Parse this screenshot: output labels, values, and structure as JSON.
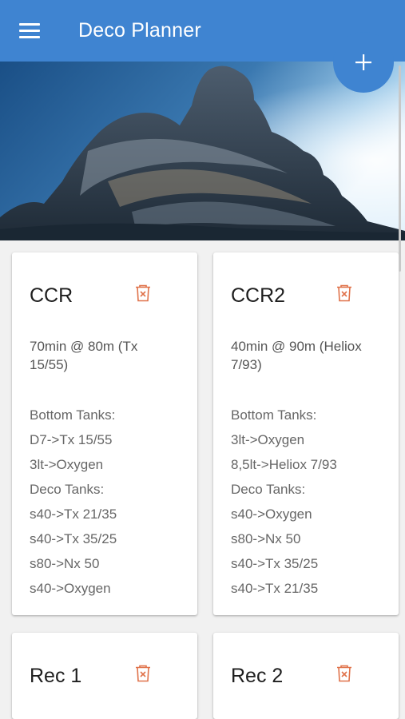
{
  "app": {
    "title": "Deco Planner",
    "accent_color": "#3f84d1",
    "menu_icon": "hamburger-icon",
    "add_icon": "plus-icon"
  },
  "cards": [
    {
      "title": "CCR",
      "delete_icon": "trash-icon",
      "summary": "70min @ 80m (Tx 15/55)",
      "bottom_label": "Bottom Tanks:",
      "bottom_tanks": [
        "D7->Tx 15/55",
        "3lt->Oxygen"
      ],
      "deco_label": "Deco Tanks:",
      "deco_tanks": [
        "s40->Tx 21/35",
        "s40->Tx 35/25",
        "s80->Nx 50",
        "s40->Oxygen"
      ]
    },
    {
      "title": "CCR2",
      "delete_icon": "trash-icon",
      "summary": "40min @ 90m (Heliox 7/93)",
      "bottom_label": "Bottom Tanks:",
      "bottom_tanks": [
        "3lt->Oxygen",
        "8,5lt->Heliox 7/93"
      ],
      "deco_label": "Deco Tanks:",
      "deco_tanks": [
        "s40->Oxygen",
        "s80->Nx 50",
        "s40->Tx 35/25",
        "s40->Tx 21/35"
      ]
    },
    {
      "title": "Rec 1",
      "delete_icon": "trash-icon"
    },
    {
      "title": "Rec 2",
      "delete_icon": "trash-icon"
    }
  ]
}
